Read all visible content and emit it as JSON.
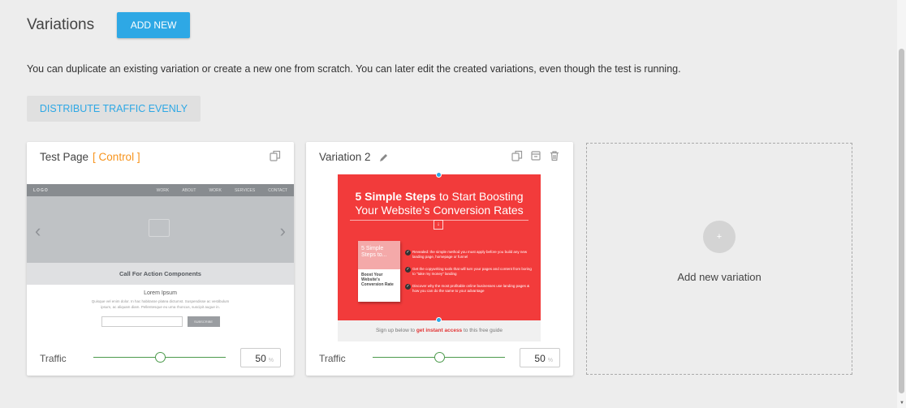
{
  "header": {
    "title": "Variations",
    "add_new_label": "ADD NEW"
  },
  "description": "You can duplicate an existing variation or create a new one from scratch. You can later edit the created variations, even though the test is running.",
  "distribute_label": "DISTRIBUTE TRAFFIC EVENLY",
  "cards": [
    {
      "title": "Test Page",
      "badge": "[ Control ]",
      "thumbnail": {
        "nav_logo": "LOGO",
        "nav_links": [
          "WORK",
          "ABOUT",
          "WORK",
          "SERVICES",
          "CONTACT"
        ],
        "cta": "Call For Action Components",
        "heading": "Lorem Ipsum",
        "paragraph": "Quisque vel enim dolor. In hac habitasse platea dictumst. Suspendisse ac vestibulum ipsum, ac aliquam diam. Pellentesque eu urna rhoncus, suscipit augue in.",
        "button": "SUBSCRIBE"
      },
      "traffic_label": "Traffic",
      "traffic_value": "50",
      "traffic_unit": "%"
    },
    {
      "title": "Variation 2",
      "thumbnail": {
        "headline_bold": "5 Simple Steps",
        "headline_rest": " to Start Boosting",
        "headline_line2": "Your Website's Conversion Rates",
        "book_top": "5 Simple Steps to...",
        "book_bottom": "Boost Your Website's Conversion Rate",
        "bullets": [
          "Revealed: the simple method you must apply before you build any new landing page, homepage or funnel",
          "Get the copywriting tools that will turn your pages and content from boring to \"take my money\" landing",
          "Discover why the most profitable online businesses use landing pages & how you can do the same to your advantage"
        ],
        "footer_pre": "Sign up below to ",
        "footer_bold": "get instant access",
        "footer_post": " to this free guide"
      },
      "traffic_label": "Traffic",
      "traffic_value": "50",
      "traffic_unit": "%"
    }
  ],
  "add_card": {
    "plus": "+",
    "label": "Add new variation"
  },
  "icons": {
    "duplicate": "duplicate-icon",
    "edit": "pencil-icon",
    "archive": "archive-icon",
    "delete": "trash-icon"
  },
  "colors": {
    "accent": "#2ea8e5",
    "control": "#f7941d",
    "slider": "#4c9a4c",
    "variation_bg": "#f23b3b"
  }
}
